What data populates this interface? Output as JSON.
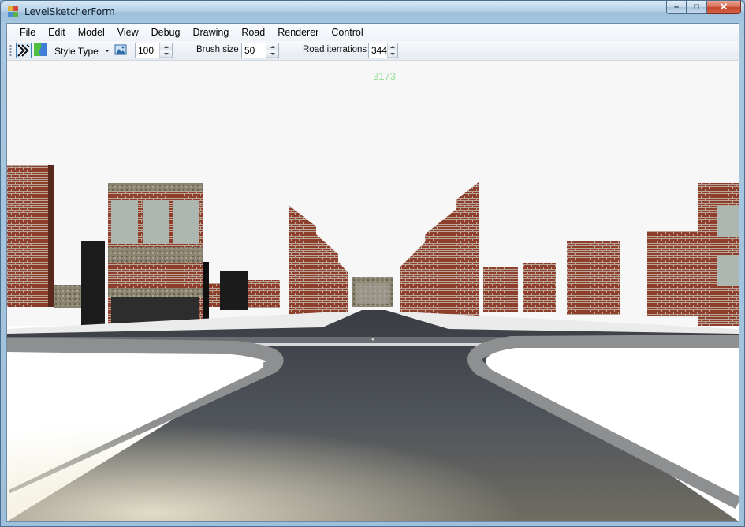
{
  "window": {
    "title": "LevelSketcherForm",
    "minimize_glyph": "–",
    "maximize_glyph": "□",
    "close_glyph": "✕"
  },
  "menu": {
    "items": [
      "File",
      "Edit",
      "Model",
      "View",
      "Debug",
      "Drawing",
      "Road",
      "Renderer",
      "Control"
    ]
  },
  "toolbar": {
    "style_type_label": "Style Type",
    "style_value": "100",
    "brush_size_label": "Brush size",
    "brush_size_value": "50",
    "road_iterations_label": "Road iterrations",
    "road_iterations_value": "344",
    "icons": [
      "road-draw-icon",
      "terrain-paint-icon",
      "image-icon"
    ]
  },
  "viewport": {
    "fps_counter": "3173"
  },
  "colors": {
    "sky": "#f7f7f7",
    "ground": "#ffffff",
    "road": "#4a4e55",
    "brick": "#8c3d2c",
    "curb": "#7d7f80",
    "fps": "#9bdc9b"
  }
}
